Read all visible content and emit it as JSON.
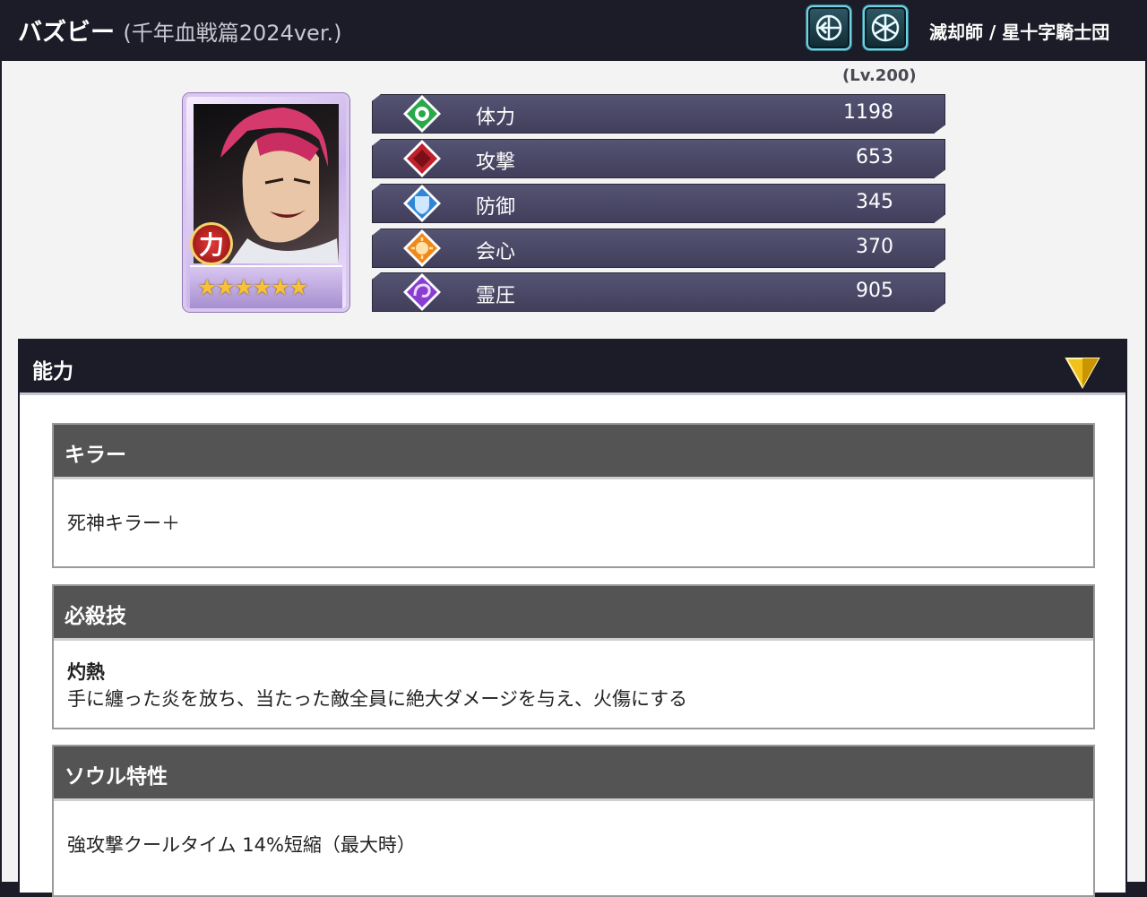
{
  "header": {
    "name": "バズビー",
    "version": "(千年血戦篇2024ver.)",
    "affiliation": "滅却師 / 星十字騎士団",
    "icons": [
      "crossbow-icon",
      "wheel-icon"
    ]
  },
  "level": "(Lv.200)",
  "portrait": {
    "badge": "力",
    "stars": "★★★★★★",
    "star_count": 6
  },
  "stats": [
    {
      "label": "体力",
      "value": "1198",
      "icon": "hp-icon",
      "color": "#2aa84a"
    },
    {
      "label": "攻撃",
      "value": "653",
      "icon": "attack-icon",
      "color": "#c0202c"
    },
    {
      "label": "防御",
      "value": "345",
      "icon": "defense-icon",
      "color": "#2f86d6"
    },
    {
      "label": "会心",
      "value": "370",
      "icon": "critical-icon",
      "color": "#ef8a1a"
    },
    {
      "label": "霊圧",
      "value": "905",
      "icon": "spirit-pressure-icon",
      "color": "#8a3ed0"
    }
  ],
  "ability_panel": {
    "title": "能力",
    "sections": [
      {
        "title": "キラー",
        "name": "",
        "text": "死神キラー＋"
      },
      {
        "title": "必殺技",
        "name": "灼熱",
        "text": "手に纏った炎を放ち、当たった敵全員に絶大ダメージを与え、火傷にする"
      },
      {
        "title": "ソウル特性",
        "name": "",
        "text": "強攻撃クールタイム 14%短縮（最大時）"
      }
    ]
  },
  "colors": {
    "header_bg": "#1c1c28",
    "stat_bar": "#4a4866",
    "section_head": "#545454",
    "toggle": "#f2c21a"
  }
}
